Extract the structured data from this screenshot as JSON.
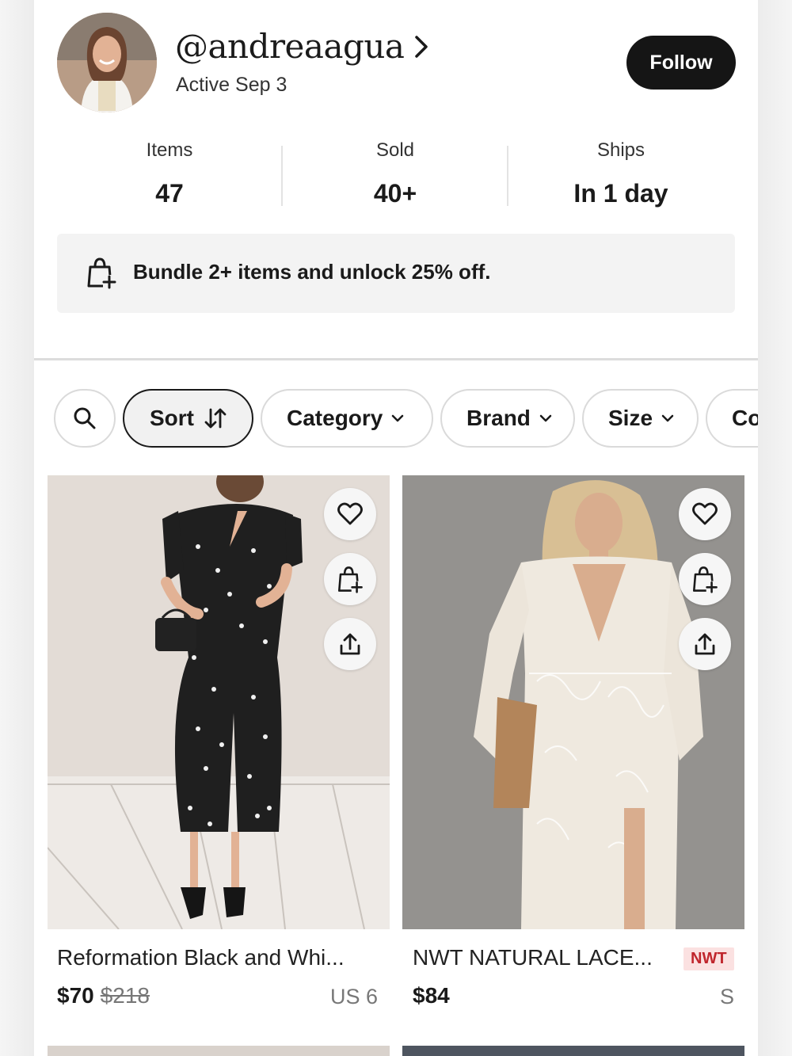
{
  "profile": {
    "username": "@andreaagua",
    "active": "Active Sep 3",
    "follow_label": "Follow"
  },
  "stats": [
    {
      "label": "Items",
      "value": "47"
    },
    {
      "label": "Sold",
      "value": "40+"
    },
    {
      "label": "Ships",
      "value": "In 1 day"
    }
  ],
  "bundle": {
    "text": "Bundle 2+ items and unlock 25% off.",
    "icon": "shopping-bag-plus-icon"
  },
  "filters": {
    "search_icon": "search-icon",
    "chips": [
      "Sort",
      "Category",
      "Brand",
      "Size",
      "Co"
    ]
  },
  "listings": [
    {
      "title": "Reformation Black and Whi...",
      "price": "$70",
      "original_price": "$218",
      "size": "US 6",
      "badge": ""
    },
    {
      "title": "NWT NATURAL LACE...",
      "price": "$84",
      "original_price": "",
      "size": "S",
      "badge": "NWT"
    }
  ],
  "colors": {
    "primary_button": "#151515",
    "badge_bg": "#fbe1e1",
    "badge_text": "#c0262d"
  }
}
